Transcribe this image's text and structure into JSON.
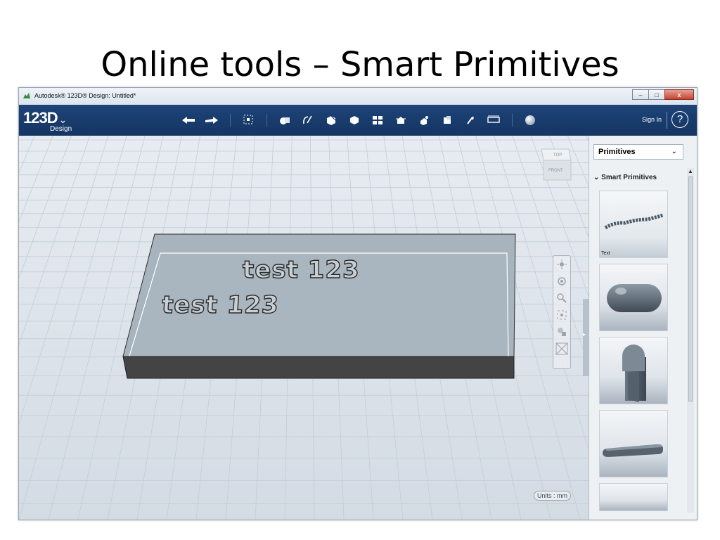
{
  "slide": {
    "title": "Online tools – Smart Primitives"
  },
  "window": {
    "title": "Autodesk® 123D® Design: Untitled*",
    "buttons": {
      "minimize": "–",
      "maximize": "□",
      "close": "x"
    }
  },
  "toolbar": {
    "logo_main": "123D",
    "logo_sub": "Design",
    "logo_chevron": "⌄",
    "sign_in": "Sign In",
    "help": "?",
    "tools": [
      "undo-icon",
      "redo-icon",
      "transform-icon",
      "primitives-icon",
      "sketch-icon",
      "construct-icon",
      "modify-icon",
      "pattern-icon",
      "grouping-icon",
      "snap-icon",
      "combine-icon",
      "measure-icon",
      "material-icon",
      "render-sphere-icon"
    ]
  },
  "viewcube": {
    "top": "TOP",
    "front": "FRONT"
  },
  "viewport": {
    "text_back": "test 123",
    "text_front": "test 123",
    "units": "Units : mm"
  },
  "panel": {
    "dropdown": "Primitives",
    "section": "Smart Primitives",
    "items": [
      {
        "label": "Text",
        "shape": "text-primitive-icon"
      },
      {
        "label": "",
        "shape": "capsule-primitive-icon"
      },
      {
        "label": "",
        "shape": "rounded-bracket-primitive-icon"
      },
      {
        "label": "",
        "shape": "slot-primitive-icon"
      }
    ]
  },
  "colors": {
    "toolbar": "#1a3d70",
    "grid_bg": "#dfe6ee",
    "box_top": "#a9b4bd",
    "box_side": "#3d3d3d"
  }
}
